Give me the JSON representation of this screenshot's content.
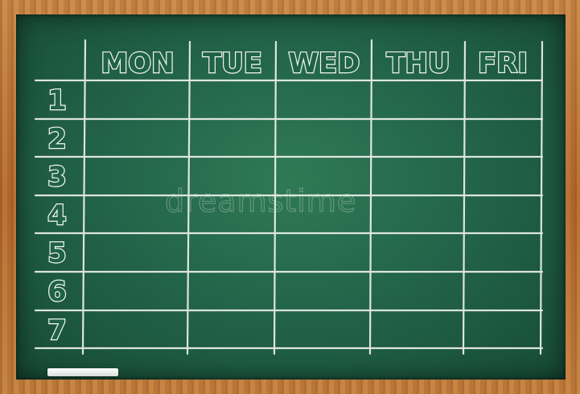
{
  "days": [
    "MON",
    "TUE",
    "WED",
    "THU",
    "FRI"
  ],
  "periods": [
    "1",
    "2",
    "3",
    "4",
    "5",
    "6",
    "7"
  ],
  "watermark": "dreamstime",
  "colors": {
    "board": "#23654a",
    "chalk": "#f4f6f2",
    "frame": "#b26a2e"
  }
}
